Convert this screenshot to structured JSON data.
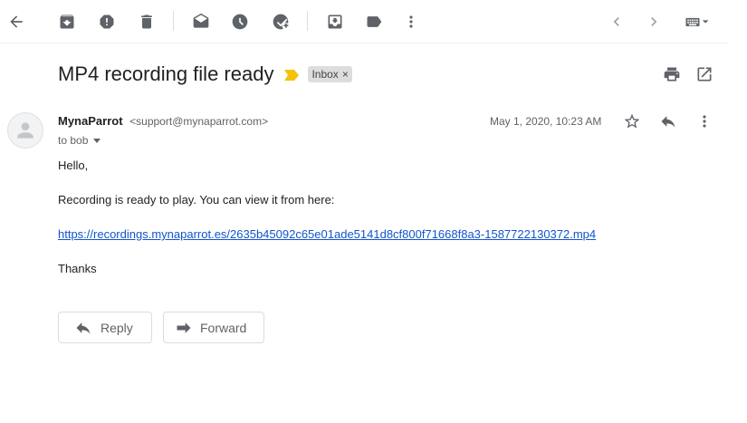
{
  "toolbar": {
    "icons": [
      "back-arrow-icon",
      "archive-icon",
      "report-spam-icon",
      "delete-icon",
      "mark-unread-icon",
      "snooze-icon",
      "add-task-icon",
      "move-to-icon",
      "label-icon",
      "more-vert-icon",
      "newer-chevron-icon",
      "older-chevron-icon",
      "keyboard-icon"
    ]
  },
  "email": {
    "subject": "MP4 recording file ready",
    "label": "Inbox",
    "label_remove": "×",
    "sender_name": "MynaParrot",
    "sender_email": "<support@mynaparrot.com>",
    "to_line": "to bob",
    "date": "May 1, 2020, 10:23 AM",
    "body": {
      "greeting": "Hello,",
      "line1": "Recording is ready to play. You can view it from here:",
      "link": "https://recordings.mynaparrot.es/2635b45092c65e01ade5141d8cf800f71668f8a3-1587722130372.mp4",
      "closing": "Thanks"
    }
  },
  "actions": {
    "reply_label": "Reply",
    "forward_label": "Forward"
  },
  "colors": {
    "link": "#1155cc",
    "importance_marker": "#f4c20d",
    "chip_background": "#dddddd"
  }
}
